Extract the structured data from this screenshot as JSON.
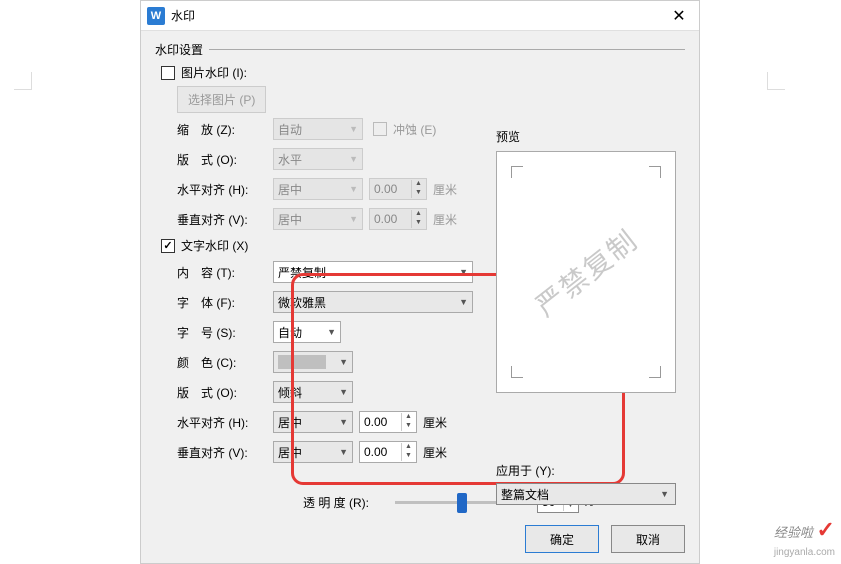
{
  "dialog": {
    "title": "水印",
    "fieldset_label": "水印设置"
  },
  "image_watermark": {
    "checkbox_label": "图片水印 (I):",
    "select_image_btn": "选择图片 (P)",
    "zoom_label": "缩　放 (Z):",
    "zoom_value": "自动",
    "erosion_label": "冲蚀 (E)",
    "layout_label": "版　式 (O):",
    "layout_value": "水平",
    "halign_label": "水平对齐 (H):",
    "halign_value": "居中",
    "halign_num": "0.00",
    "valign_label": "垂直对齐 (V):",
    "valign_value": "居中",
    "valign_num": "0.00",
    "unit": "厘米"
  },
  "text_watermark": {
    "checkbox_label": "文字水印 (X)",
    "content_label": "内　容 (T):",
    "content_value": "严禁复制",
    "font_label": "字　体 (F):",
    "font_value": "微软雅黑",
    "size_label": "字　号 (S):",
    "size_value": "自动",
    "color_label": "颜　色 (C):",
    "layout_label": "版　式 (O):",
    "layout_value": "倾斜",
    "halign_label": "水平对齐 (H):",
    "halign_value": "居中",
    "halign_num": "0.00",
    "valign_label": "垂直对齐 (V):",
    "valign_value": "居中",
    "valign_num": "0.00",
    "unit": "厘米"
  },
  "opacity": {
    "label": "透 明 度 (R):",
    "value": "50"
  },
  "preview": {
    "label": "预览",
    "watermark_text": "严禁复制"
  },
  "apply": {
    "label": "应用于 (Y):",
    "value": "整篇文档"
  },
  "buttons": {
    "ok": "确定",
    "cancel": "取消"
  },
  "logo": {
    "text": "经验啦",
    "sub": "jingyanla.com"
  }
}
